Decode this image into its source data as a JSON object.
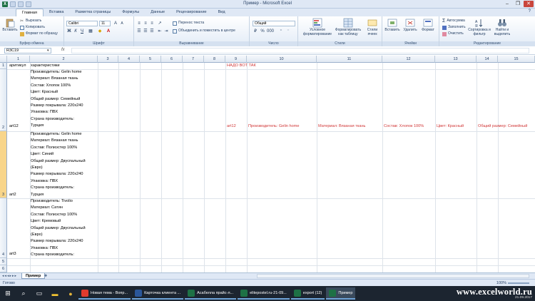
{
  "window": {
    "title": "Пример - Microsoft Excel"
  },
  "tabs": [
    "Главная",
    "Вставка",
    "Разметка страницы",
    "Формулы",
    "Данные",
    "Рецензирование",
    "Вид"
  ],
  "ribbon": {
    "clipboard": {
      "paste": "Вставить",
      "cut": "Вырезать",
      "copy": "Копировать",
      "format_painter": "Формат по образцу",
      "label": "Буфер обмена"
    },
    "font": {
      "name": "Calibri",
      "size": "11",
      "label": "Шрифт"
    },
    "alignment": {
      "wrap": "Перенос текста",
      "merge": "Объединить и поместить в центре",
      "label": "Выравнивание"
    },
    "number": {
      "format": "Общий",
      "label": "Число"
    },
    "styles": {
      "conditional": "Условное форматирование",
      "as_table": "Форматировать как таблицу",
      "cell_styles": "Стили ячеек",
      "label": "Стили"
    },
    "cells": {
      "insert": "Вставить",
      "delete": "Удалить",
      "format": "Формат",
      "label": "Ячейки"
    },
    "editing": {
      "autosum": "Автосумма",
      "fill": "Заполнить",
      "clear": "Очистить",
      "sort": "Сортировка и фильтр",
      "find": "Найти и выделить",
      "label": "Редактирование"
    }
  },
  "formula_bar": {
    "name_box": "R3C19",
    "fx": "fx",
    "content": ""
  },
  "grid": {
    "columns": [
      "1",
      "2",
      "3",
      "4",
      "5",
      "6",
      "7",
      "8",
      "9",
      "10",
      "11",
      "12",
      "13",
      "14",
      "15"
    ],
    "rows": [
      "1",
      "2",
      "3",
      "4",
      "5",
      "6",
      "7"
    ],
    "cells": {
      "r1c1": "аритикул",
      "r1c2": "характеристики",
      "r1c9": "НАДО ВОТ ТАК",
      "r2c1": "art12",
      "r2c2": "Производитель: Gelin home\nМатериал: Вязаная ткань\nСостав: Хлопок 100%\nЦвет: Красный\nОбщий размер: Семейный\nРазмер покрывала: 220х240\nУпаковка: ПВХ\nСтрана производитель:\nТурция",
      "r2c9": "art12",
      "r2c10": "Производитель: Gelin home",
      "r2c11": "Материал: Вязаная ткань",
      "r2c12": "Состав: Хлопок 100%",
      "r2c13": "Цвет: Красный",
      "r2c14": "Общий размер: Семейный",
      "r3c1": "art2",
      "r3c2": "Производитель: Gelin home\nМатериал: Вязаная ткань\nСостав: Полиэстер 100%\nЦвет: Синий\nОбщий размер: Двуспальный\n(Евро)\nРазмер покрывала: 220х240\nУпаковка: ПВХ\nСтрана производитель:\nТурция",
      "r4c1": "art3",
      "r4c2": "Производитель: Tivolio\nМатериал: Сатин\nСостав: Полиэстер 100%\nЦвет: Кремовый\nОбщий размер: Двуспальный\n(Евро)\nРазмер покрывала: 220х240\nУпаковка: ПВХ\nСтрана производитель:"
    }
  },
  "sheet_tabs": {
    "active": "Пример"
  },
  "status": {
    "ready": "Готово",
    "zoom": "100%"
  },
  "taskbar": {
    "items": [
      "Новая тема - Вопр...",
      "Карточка клиента ...",
      "Асабелла прайс-л...",
      "elitepostel.ru-21-09...",
      "export (12)",
      "Пример"
    ],
    "date": "21.09.2017"
  },
  "watermark": "www.excelworld.ru",
  "colors": {
    "red_text": "#d13838",
    "selected_row_header": "#f8d58a",
    "ribbon_bg": "#dfe8f5"
  }
}
